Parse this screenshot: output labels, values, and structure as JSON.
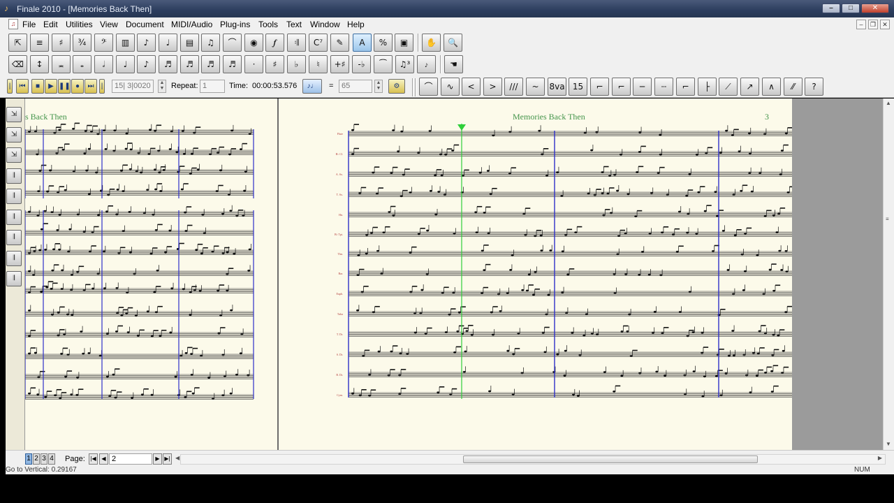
{
  "window": {
    "title": "Finale 2010 - [Memories Back Then]"
  },
  "menu": [
    "File",
    "Edit",
    "Utilities",
    "View",
    "Document",
    "MIDI/Audio",
    "Plug-ins",
    "Tools",
    "Text",
    "Window",
    "Help"
  ],
  "playback": {
    "measure_field": "15| 3|0020",
    "repeat_label": "Repeat:",
    "repeat_value": "1",
    "time_label": "Time:",
    "time_value": "00:00:53.576",
    "equals": "=",
    "tempo_value": "65"
  },
  "score": {
    "left_page_title": "s Back Then",
    "right_page_title": "Memories Back Then",
    "right_page_number": "3",
    "instruments": [
      "Flute",
      "B♭ Cl.",
      "A. Sx.",
      "T. Sx.",
      "Hn.",
      "B♭ Tpt.",
      "Tbn.",
      "Bar.",
      "Euph.",
      "Tuba",
      "T. Dr.",
      "S. Dr.",
      "B. Dr.",
      "Cym."
    ]
  },
  "bottom": {
    "page_tabs": [
      "1",
      "2",
      "3",
      "4"
    ],
    "page_label": "Page:",
    "page_value": "2"
  },
  "status": {
    "left_text": "Go to Vertical: 0.29167",
    "right_text": "NUM"
  },
  "colors": {
    "page_paper": "#fcfaea",
    "title_green": "#43944a",
    "barline_blue": "#2e2fc8",
    "playback_cursor": "#2fcf3a",
    "titlebar": "#2c3d5e"
  }
}
